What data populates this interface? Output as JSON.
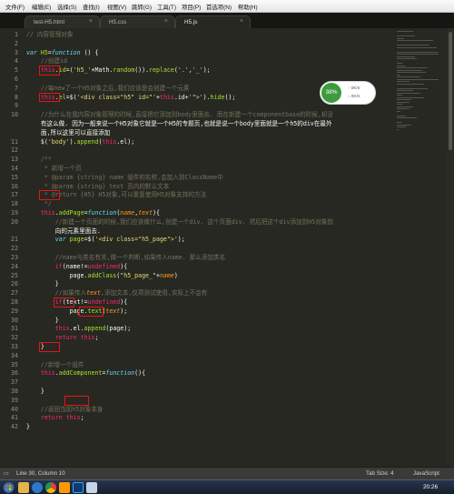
{
  "menu": [
    "文件(F)",
    "编辑(E)",
    "选择(S)",
    "查找(I)",
    "视图(V)",
    "跳转(G)",
    "工具(T)",
    "项目(P)",
    "首选项(N)",
    "帮助(H)"
  ],
  "tabs": [
    "test-H5.html",
    "H5.css",
    "H5.js"
  ],
  "active_tab": "H5.js",
  "tab_close_glyph": "×",
  "code_lines": [
    {
      "n": "1",
      "t": "// 内容管理对象"
    },
    {
      "n": "2",
      "t": ""
    },
    {
      "n": "3",
      "t": "var H5=function () {"
    },
    {
      "n": "4",
      "t": "    //创建id"
    },
    {
      "n": "5",
      "t": "    this.id=('h5_'+Math.random()).replace('.','_');"
    },
    {
      "n": "6",
      "t": ""
    },
    {
      "n": "7",
      "t": "    //每new了一个H5对象之后,我们应该是会创建一个元素"
    },
    {
      "n": "8",
      "t": "    this.el=$('<div class=\"h5\" id=\"'+this.id+'\">').hide();"
    },
    {
      "n": "9",
      "t": ""
    },
    {
      "n": "10",
      "t": "    //为什么在我内容对象管理的时候,直接把它添加到body里面去. 而在新建一个componentbase的时候,却没"
    },
    {
      "n": "",
      "t": "    有这么做. 因为一般来说一个H5对象它就是一个H5的专题页,也就是说一个body里面就是一个h5的div在最外"
    },
    {
      "n": "",
      "t": "    面,所以这里可以直接添加"
    },
    {
      "n": "11",
      "t": "    $('body').append(this.el);"
    },
    {
      "n": "12",
      "t": ""
    },
    {
      "n": "13",
      "t": "    /**"
    },
    {
      "n": "14",
      "t": "     * 新增一个页"
    },
    {
      "n": "15",
      "t": "     * @param {string} name 组件的名称,会加入到ClassName中"
    },
    {
      "n": "16",
      "t": "     * @param {string} text 页内的默认文本"
    },
    {
      "n": "17",
      "t": "     * @return {H5} H5对象,可以重复使用H5对象支持的方法"
    },
    {
      "n": "18",
      "t": "     */"
    },
    {
      "n": "19",
      "t": "    this.addPage=function(name,text){"
    },
    {
      "n": "20",
      "t": "        //新建一个页面的时候,我们应该做什么,创建一个div. 这个页面div. 然后把这个div添加到H5对象指"
    },
    {
      "n": "",
      "t": "        向的元素里面去."
    },
    {
      "n": "21",
      "t": "        var page=$('<div class=\"h5_page\">');"
    },
    {
      "n": "22",
      "t": ""
    },
    {
      "n": "23",
      "t": "        //name与类名有关,做一个判断,如果传入name. 那么添加类名"
    },
    {
      "n": "24",
      "t": "        if(name!=undefined){"
    },
    {
      "n": "25",
      "t": "            page.addClass(\"h5_page_\"+name)"
    },
    {
      "n": "26",
      "t": "        }"
    },
    {
      "n": "27",
      "t": "        //如果传入text,添加文本,仅项测试使用,实际上不会有"
    },
    {
      "n": "28",
      "t": "        if(text!=undefined){"
    },
    {
      "n": "29",
      "t": "            page.text(text);"
    },
    {
      "n": "30",
      "t": "        }"
    },
    {
      "n": "31",
      "t": "        this.el.append(page);"
    },
    {
      "n": "32",
      "t": "        return this;"
    },
    {
      "n": "33",
      "t": "    }"
    },
    {
      "n": "34",
      "t": ""
    },
    {
      "n": "35",
      "t": "    //新增一个组件"
    },
    {
      "n": "36",
      "t": "    this.addComponent=function(){"
    },
    {
      "n": "37",
      "t": ""
    },
    {
      "n": "38",
      "t": "    }"
    },
    {
      "n": "39",
      "t": ""
    },
    {
      "n": "40",
      "t": "    //返回当前h5对象本身"
    },
    {
      "n": "41",
      "t": "    return this;"
    },
    {
      "n": "42",
      "t": "}"
    }
  ],
  "overlay": {
    "percent": "38%",
    "up_rate": "0K/s",
    "down_rate": "0K/s",
    "up_arrow": "↑",
    "down_arrow": "↓"
  },
  "status": {
    "position": "Line 30, Column 10",
    "tab_size": "Tab Size: 4",
    "syntax": "JavaScript"
  },
  "clock": "20:26",
  "colors": {
    "background": "#272822",
    "keyword": "#f92672",
    "string": "#e6db74",
    "function": "#a6e22e",
    "comment": "#75715e",
    "storage": "#66d9ef",
    "parameter": "#fd971f",
    "highlight_box": "#ee1111",
    "overlay_ring": "#3d9b3d"
  },
  "icons": [
    "windows-start-icon",
    "file-explorer-icon",
    "browser-icon",
    "chrome-icon",
    "sublime-text-icon",
    "photoshop-icon",
    "notepad-icon"
  ]
}
